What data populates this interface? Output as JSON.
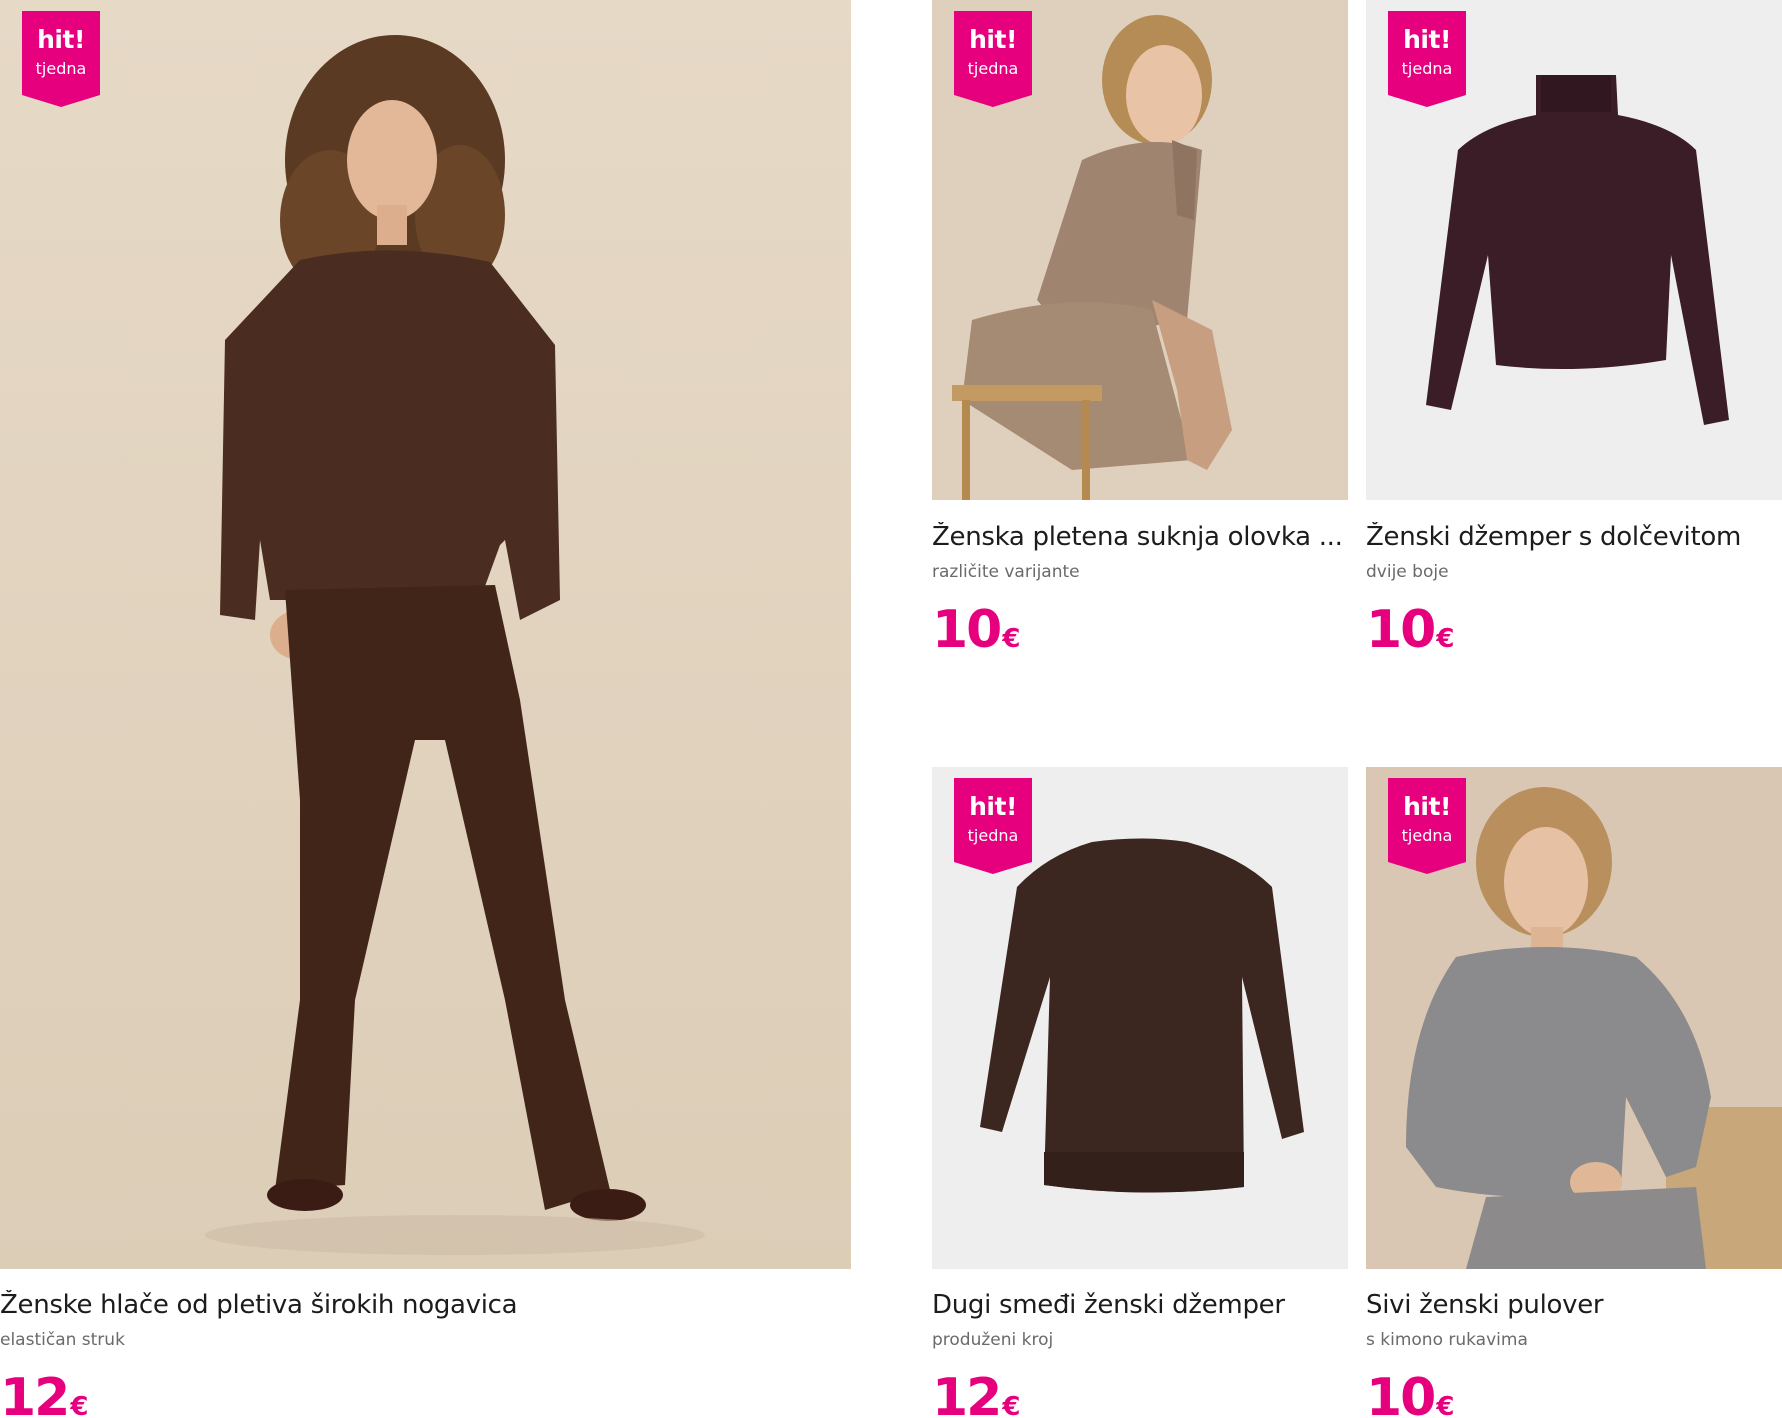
{
  "badge": {
    "line1": "hit!",
    "line2": "tjedna",
    "color": "#e6007e"
  },
  "products": [
    {
      "name": "Ženske hlače od pletiva širokih nogavica",
      "note": "elastičan struk",
      "price": "12",
      "currency": "€",
      "image_icon": "model-brown-knit-set-image"
    },
    {
      "name": "Ženska pletena suknja olovka ...",
      "note": "različite varijante",
      "price": "10",
      "currency": "€",
      "image_icon": "model-beige-knit-skirt-image"
    },
    {
      "name": "Ženski džemper s dolčevitom",
      "note": "dvije boje",
      "price": "10",
      "currency": "€",
      "image_icon": "burgundy-turtleneck-sweater-image"
    },
    {
      "name": "Dugi smeđi ženski džemper",
      "note": "produženi kroj",
      "price": "12",
      "currency": "€",
      "image_icon": "brown-long-sweater-image"
    },
    {
      "name": "Sivi ženski pulover",
      "note": "s kimono rukavima",
      "price": "10",
      "currency": "€",
      "image_icon": "model-grey-pullover-image"
    }
  ]
}
